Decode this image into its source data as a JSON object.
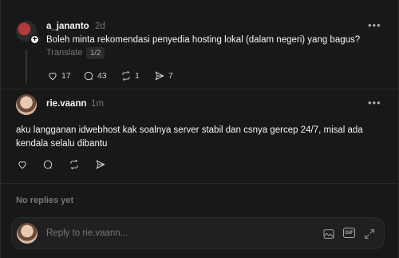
{
  "post1": {
    "username": "a_jananto",
    "time": "2d",
    "text": "Boleh minta rekomendasi penyedia hosting lokal (dalam negeri) yang bagus?",
    "translate": "Translate",
    "page": "1/2",
    "likes": "17",
    "comments": "43",
    "reposts": "1",
    "shares": "7"
  },
  "post2": {
    "username": "rie.vaann",
    "time": "1m",
    "text": "aku langganan idwebhost kak soalnya server stabil dan csnya gercep 24/7, misal ada kendala selalu dibantu"
  },
  "replies": {
    "empty_label": "No replies yet"
  },
  "composer": {
    "placeholder": "Reply to rie.vaann...",
    "gif_label": "GIF"
  },
  "icons": {
    "more": "more-icon",
    "like": "heart-icon",
    "comment": "comment-icon",
    "repost": "repost-icon",
    "share": "send-icon",
    "image": "image-icon",
    "gif": "gif-icon",
    "expand": "expand-icon"
  }
}
